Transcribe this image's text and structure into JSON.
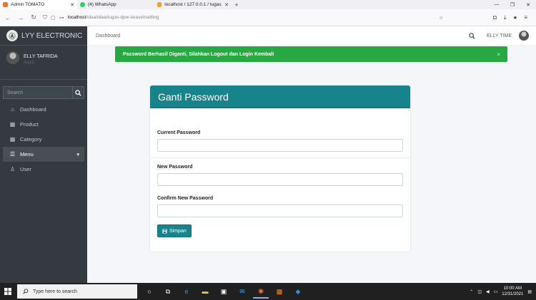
{
  "browser": {
    "tabs": [
      {
        "title": "Admin TOMATO",
        "active": true
      },
      {
        "title": "(4) WhatsApp",
        "active": false
      },
      {
        "title": "localhost / 127.0.0.1 / tugas_dp",
        "active": false
      }
    ],
    "new_tab": "+",
    "url_host": "localhost",
    "url_path": "/idaa/idaa/tugas-dpw-laravel/setting",
    "window_controls": [
      "—",
      "❐",
      "✕"
    ]
  },
  "sidebar": {
    "brand": "LYY ELECTRONIC",
    "brand_logo": "Ⓐ",
    "user_name": "ELLY TAFRIDA",
    "user_sub": "(tags)",
    "search_placeholder": "Search",
    "items": [
      {
        "label": "Dashboard",
        "icon": "home-icon"
      },
      {
        "label": "Product",
        "icon": "grid-icon"
      },
      {
        "label": "Category",
        "icon": "grid-icon"
      },
      {
        "label": "Menu",
        "icon": "list-icon"
      },
      {
        "label": "User",
        "icon": "user-icon"
      }
    ]
  },
  "header": {
    "breadcrumb": "Dashboard",
    "user_label": "ELLY TIME"
  },
  "alert": {
    "message": "Password Berhasil Diganti, Silahkan Logout dan Login Kembali",
    "close": "×",
    "color": "#28a745"
  },
  "card": {
    "title": "Ganti Password",
    "header_color": "#17838a",
    "fields": {
      "current_label": "Current Password",
      "new_label": "New Password",
      "confirm_label": "Confirm New Password"
    },
    "save_label": "Simpan"
  },
  "taskbar": {
    "search_placeholder": "Type here to search",
    "time": "10:00 AM",
    "date": "12/31/2021"
  }
}
